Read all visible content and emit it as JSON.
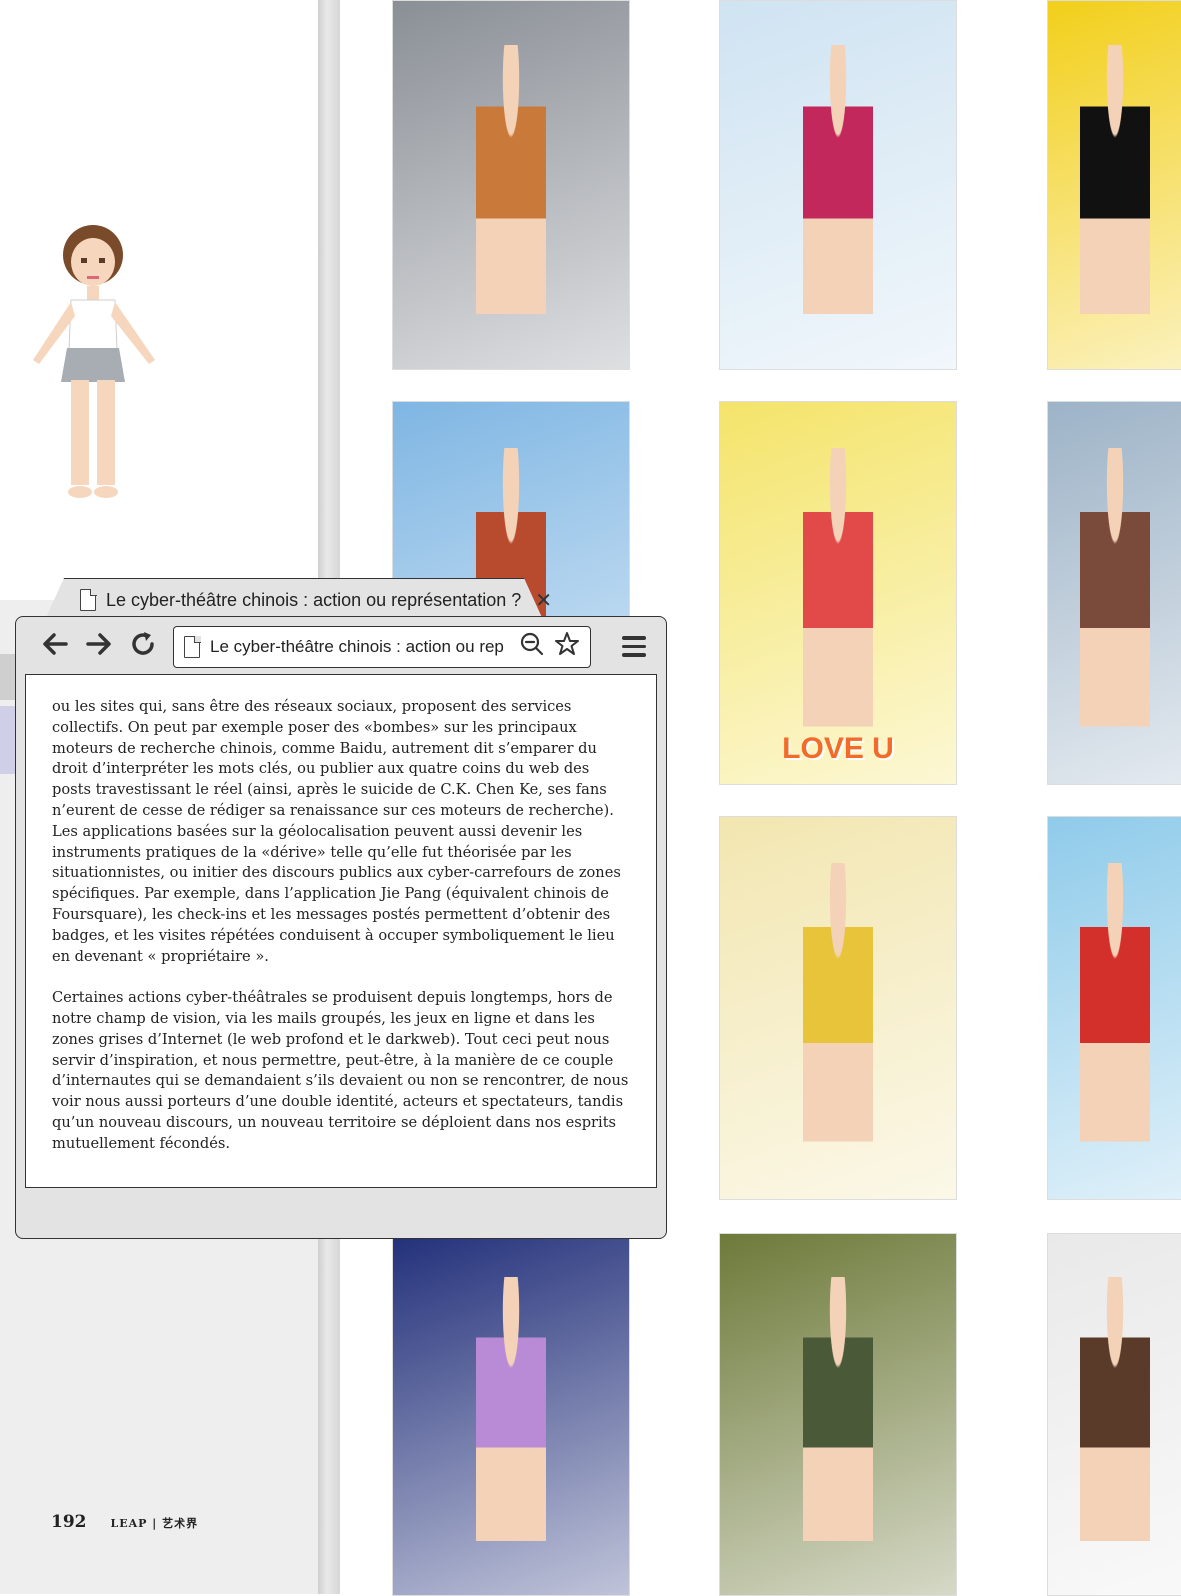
{
  "browser": {
    "tab_title": "Le cyber-théâtre chinois : action ou représentation ?",
    "tab_close": "✕",
    "url_text": "Le cyber-théâtre chinois : action ou rep",
    "back_icon": "arrow-left",
    "forward_icon": "arrow-right",
    "reload_icon": "reload",
    "zoom_icon": "zoom-out",
    "bookmark_icon": "star",
    "menu_icon": "hamburger"
  },
  "article": {
    "paragraphs": [
      "ou les sites qui, sans être des réseaux sociaux, proposent des services collectifs. On peut par exemple poser des «bombes» sur les principaux moteurs de recherche chinois, comme Baidu, autrement dit s’emparer du droit d’interpréter les mots clés, ou publier aux quatre coins du web des posts travestissant le réel (ainsi, après le suicide de C.K. Chen Ke, ses fans n’eurent de cesse de rédiger sa renaissance sur ces moteurs de recherche). Les applications basées sur la géolocalisation peuvent aussi devenir les instruments pratiques de la «dérive» telle qu’elle fut théorisée par les situationnistes, ou initier des discours publics aux cyber-carrefours de zones spécifiques. Par exemple, dans l’application Jie Pang (équivalent chinois de Foursquare), les check-ins et les messages postés permettent d’obtenir des badges, et les visites répétées conduisent à occuper symboliquement le lieu en devenant « propriétaire ».",
      "Certaines actions cyber-théâtrales se produisent depuis longtemps, hors de notre champ de vision, via les mails groupés, les jeux en ligne et dans les zones grises d’Internet (le web profond et le darkweb). Tout ceci peut nous servir d’inspiration, et nous permettre, peut-être, à la manière de ce couple d’internautes qui se demandaient s’ils devaient ou non se rencontrer, de nous voir nous aussi porteurs d’une double identité, acteurs et spectateurs, tandis qu’un nouveau discours, un nouveau territoire se déploient dans nos esprits mutuellement fécondés."
    ]
  },
  "footer": {
    "page_number": "192",
    "brand": "LEAP | 艺术界"
  },
  "thumbnails": [
    {
      "bg": "#8a8f96",
      "accent": "#c97a3a"
    },
    {
      "bg": "#cfe3f2",
      "accent": "#c2285c"
    },
    {
      "bg": "#f2cf1a",
      "accent": "#111111"
    },
    {
      "bg": "#7fb6e3",
      "accent": "#b84a2e"
    },
    {
      "bg": "#f4e46a",
      "accent": "#e24a4a",
      "caption": "LOVE U"
    },
    {
      "bg": "#9db3c7",
      "accent": "#7a4b3a"
    },
    {
      "bg": "#f2e6b0",
      "accent": "#e8c43a"
    },
    {
      "bg": "#8fcbea",
      "accent": "#d3302c"
    },
    {
      "bg": "#22307a",
      "accent": "#b98bd6"
    },
    {
      "bg": "#6e7a3a",
      "accent": "#4a5a38"
    },
    {
      "bg": "#e9e9e9",
      "accent": "#5a3b2a"
    }
  ]
}
